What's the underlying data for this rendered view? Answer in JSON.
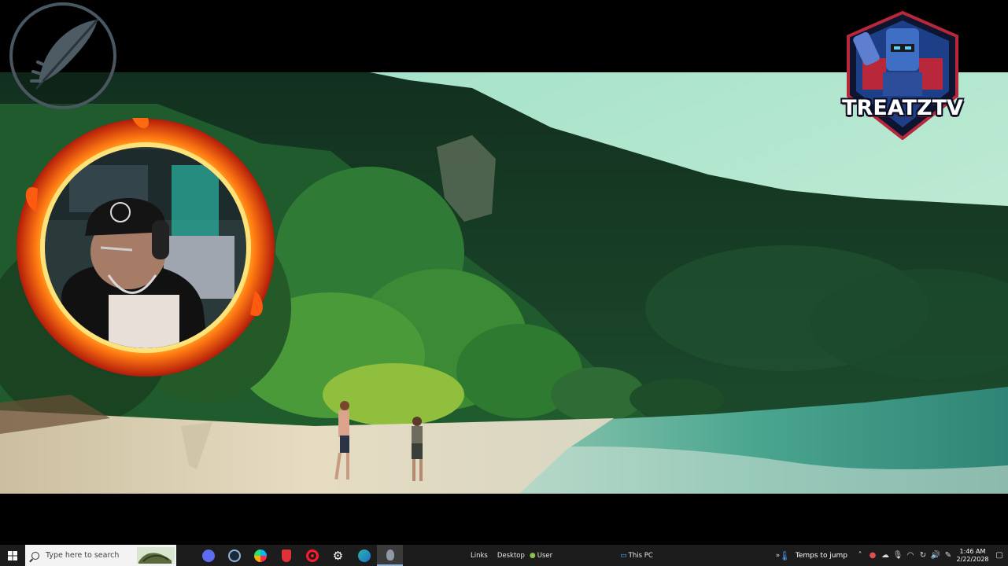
{
  "overlay": {
    "brand_name": "TREATZTV"
  },
  "taskbar": {
    "search_placeholder": "Type here to search",
    "toolbars": [
      "Links",
      "Desktop",
      "User",
      "This PC"
    ],
    "apps": [
      {
        "name": "chrome-like-icon",
        "color": "#5b6cf0"
      },
      {
        "name": "steam-icon",
        "color": "#1b2838"
      },
      {
        "name": "logitech-icon",
        "color": "#ffb100"
      },
      {
        "name": "streamlabs-icon",
        "color": "#e0303a"
      },
      {
        "name": "opera-icon",
        "color": "#ff1b2d"
      },
      {
        "name": "settings-icon",
        "color": "#ffffff"
      },
      {
        "name": "edge-icon",
        "color": "#2bb7a6"
      },
      {
        "name": "feather-app-icon",
        "color": "#8f9aa6"
      }
    ],
    "weather_text": "Temps to jump",
    "time": "1:46 AM",
    "date": "2/22/2028",
    "accent": "#1c1c1c"
  }
}
